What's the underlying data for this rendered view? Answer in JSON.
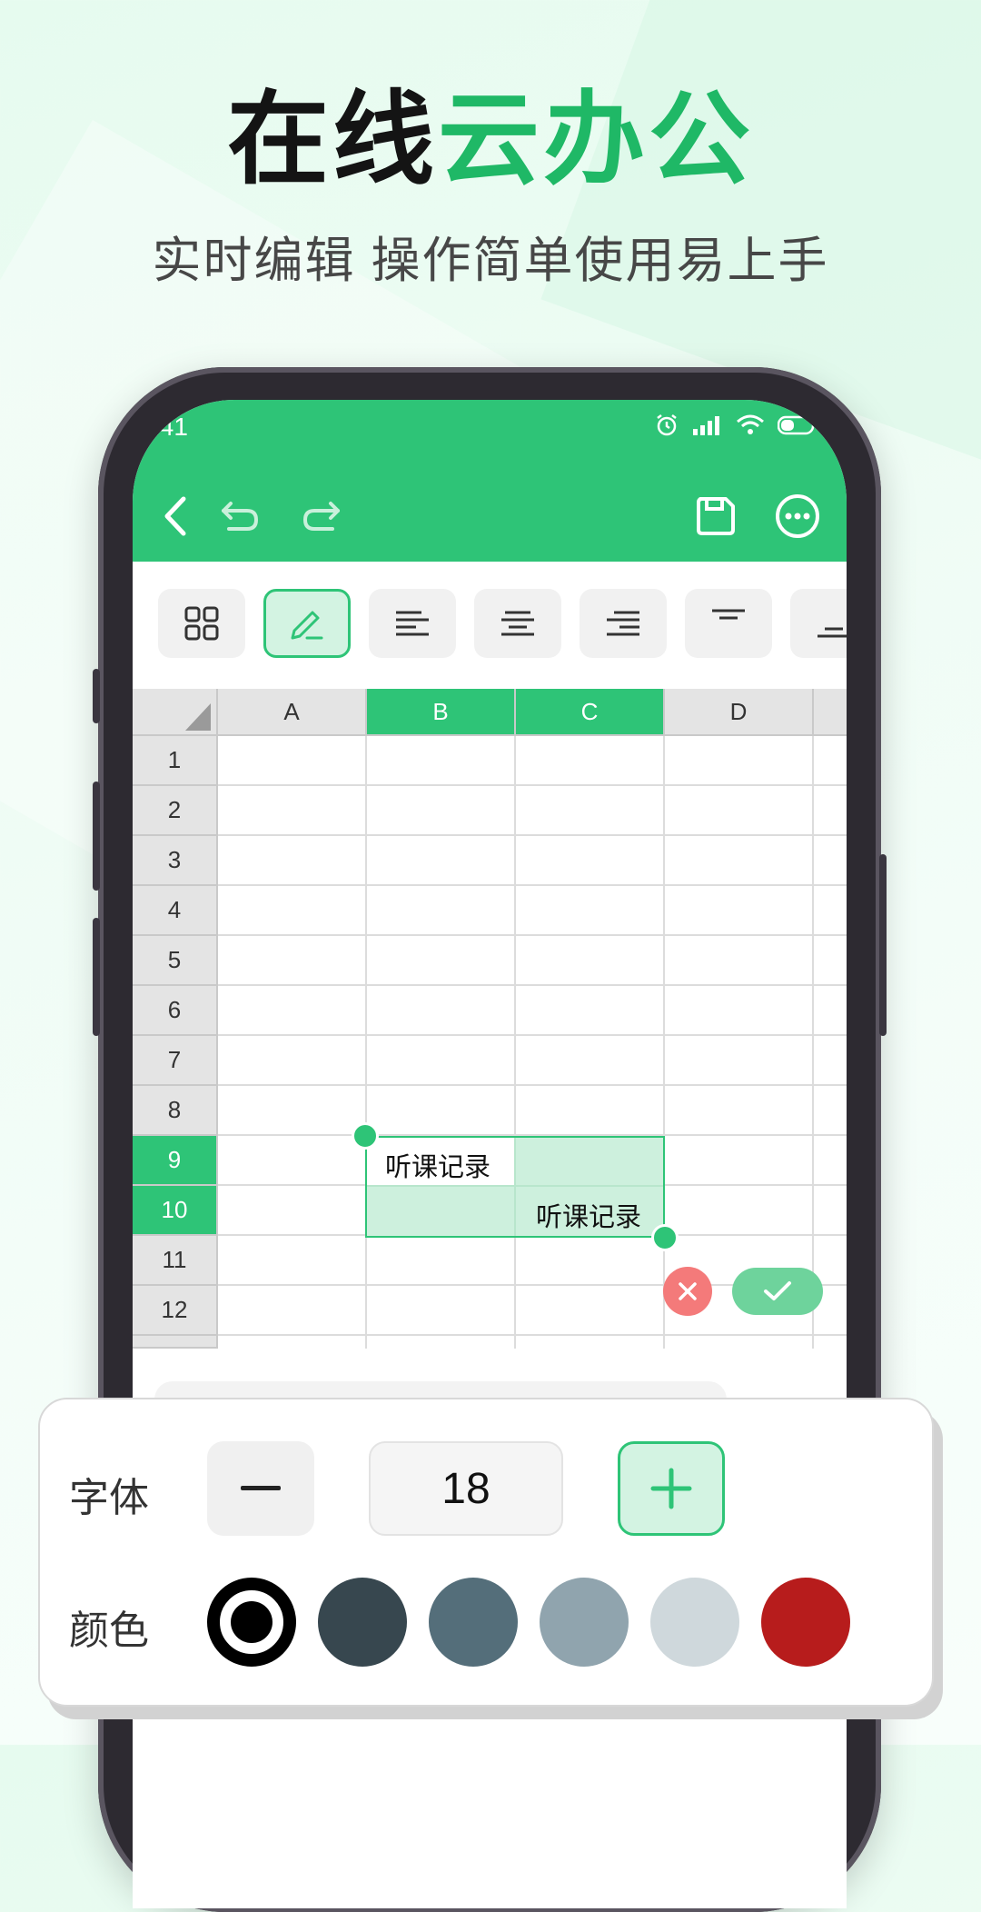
{
  "headline": {
    "part1": "在线",
    "part2": "云办公"
  },
  "subheadline": "实时编辑 操作简单使用易上手",
  "status_bar": {
    "time": ":41"
  },
  "toolbar": {
    "back_icon": "back-chevron-icon",
    "undo_icon": "undo-icon",
    "redo_icon": "redo-icon",
    "save_icon": "save-icon",
    "more_icon": "more-icon"
  },
  "format_tools": [
    "grid-icon",
    "edit-icon",
    "align-left-icon",
    "align-center-icon",
    "align-right-icon",
    "align-top-icon",
    "align-bottom-icon"
  ],
  "sheet": {
    "columns": [
      "A",
      "B",
      "C",
      "D"
    ],
    "selected_columns": [
      "B",
      "C"
    ],
    "rows": [
      "1",
      "2",
      "3",
      "4",
      "5",
      "6",
      "7",
      "8",
      "9",
      "10",
      "11",
      "12"
    ],
    "selected_rows": [
      "9",
      "10"
    ],
    "cells": {
      "B9": "听课记录",
      "C10": "听课记录"
    }
  },
  "panel": {
    "font_label": "字体",
    "font_size": "18",
    "color_label": "颜色",
    "colors": [
      "#000000",
      "#37474f",
      "#546e7a",
      "#90a4ae",
      "#cfd8dc",
      "#b71c1c"
    ],
    "accent": "#2ec477"
  }
}
